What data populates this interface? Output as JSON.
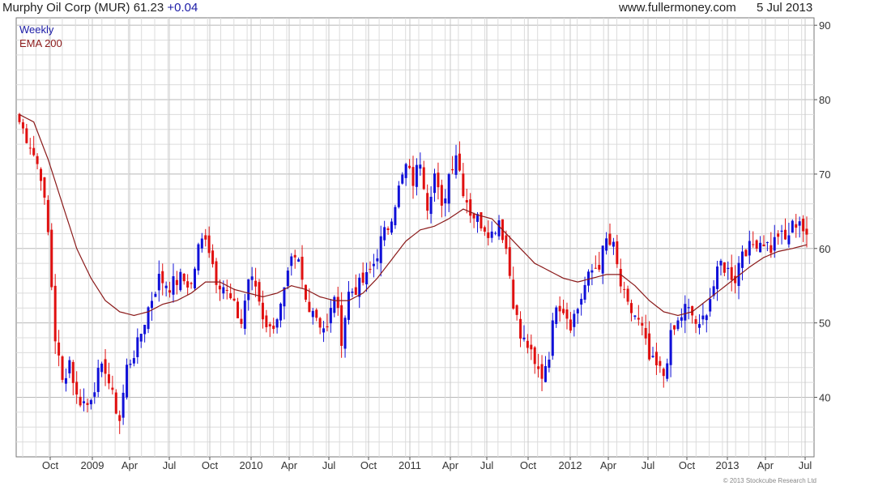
{
  "header": {
    "symbol_title": "Murphy Oil Corp (MUR)",
    "last_price": "61.23",
    "change": "+0.04",
    "website": "www.fullermoney.com",
    "date": "5 Jul 2013"
  },
  "footer": {
    "copyright": "© 2013 Stockcube Research Ltd"
  },
  "colors": {
    "up": "#1010d8",
    "down": "#e01010",
    "ema": "#8b1a1a",
    "grid": "#dcdcdc",
    "weekly_label": "#1a1aa6",
    "ema_label": "#8b1a1a"
  },
  "chart_data": {
    "type": "candlestick",
    "legend": [
      "Weekly",
      "EMA 200"
    ],
    "legend_position": "top-left",
    "grid": true,
    "y_axis_side": "right",
    "ylim": [
      32,
      91
    ],
    "y_ticks": [
      40,
      50,
      60,
      70,
      80,
      90
    ],
    "x_ticks": [
      "Oct",
      "2009",
      "Apr",
      "Jul",
      "Oct",
      "2010",
      "Apr",
      "Jul",
      "Oct",
      "2011",
      "Apr",
      "Jul",
      "Oct",
      "2012",
      "Apr",
      "Jul",
      "Oct",
      "2013",
      "Apr",
      "Jul"
    ],
    "week_close_anchors": [
      [
        0,
        77
      ],
      [
        3,
        74
      ],
      [
        6,
        70
      ],
      [
        8,
        62
      ],
      [
        10,
        48
      ],
      [
        12,
        42
      ],
      [
        14,
        45
      ],
      [
        16,
        40
      ],
      [
        19,
        39
      ],
      [
        22,
        43
      ],
      [
        24,
        44
      ],
      [
        26,
        40
      ],
      [
        28,
        37
      ],
      [
        30,
        44
      ],
      [
        33,
        47
      ],
      [
        36,
        52
      ],
      [
        39,
        56
      ],
      [
        42,
        55
      ],
      [
        45,
        56
      ],
      [
        48,
        55
      ],
      [
        50,
        60
      ],
      [
        52,
        62
      ],
      [
        55,
        56
      ],
      [
        57,
        55
      ],
      [
        60,
        52
      ],
      [
        62,
        50
      ],
      [
        64,
        56
      ],
      [
        66,
        55
      ],
      [
        68,
        51
      ],
      [
        70,
        49
      ],
      [
        73,
        52
      ],
      [
        76,
        58
      ],
      [
        78,
        58
      ],
      [
        80,
        53
      ],
      [
        82,
        52
      ],
      [
        84,
        50
      ],
      [
        86,
        49
      ],
      [
        88,
        54
      ],
      [
        90,
        48
      ],
      [
        92,
        54
      ],
      [
        95,
        55
      ],
      [
        97,
        56
      ],
      [
        99,
        58
      ],
      [
        101,
        61
      ],
      [
        103,
        63
      ],
      [
        106,
        68
      ],
      [
        108,
        71
      ],
      [
        110,
        69
      ],
      [
        112,
        72
      ],
      [
        114,
        66
      ],
      [
        116,
        70
      ],
      [
        118,
        65
      ],
      [
        120,
        70
      ],
      [
        122,
        73
      ],
      [
        124,
        68
      ],
      [
        126,
        65
      ],
      [
        128,
        64
      ],
      [
        130,
        63
      ],
      [
        132,
        62
      ],
      [
        134,
        64
      ],
      [
        136,
        60
      ],
      [
        138,
        53
      ],
      [
        140,
        48
      ],
      [
        142,
        47
      ],
      [
        144,
        44
      ],
      [
        146,
        43
      ],
      [
        148,
        46
      ],
      [
        150,
        53
      ],
      [
        152,
        52
      ],
      [
        154,
        50
      ],
      [
        156,
        52
      ],
      [
        158,
        55
      ],
      [
        160,
        57
      ],
      [
        162,
        58
      ],
      [
        164,
        61
      ],
      [
        166,
        60
      ],
      [
        168,
        55
      ],
      [
        170,
        52
      ],
      [
        172,
        51
      ],
      [
        174,
        49
      ],
      [
        176,
        45
      ],
      [
        178,
        44
      ],
      [
        180,
        43
      ],
      [
        182,
        48
      ],
      [
        184,
        50
      ],
      [
        186,
        52
      ],
      [
        188,
        51
      ],
      [
        190,
        49
      ],
      [
        192,
        52
      ],
      [
        194,
        55
      ],
      [
        196,
        58
      ],
      [
        198,
        57
      ],
      [
        200,
        56
      ],
      [
        202,
        60
      ],
      [
        204,
        60
      ],
      [
        206,
        61
      ],
      [
        208,
        61
      ],
      [
        210,
        60
      ],
      [
        212,
        62
      ],
      [
        214,
        61
      ],
      [
        216,
        63
      ],
      [
        218,
        64
      ],
      [
        220,
        61
      ]
    ],
    "ema_anchors": [
      [
        0,
        78
      ],
      [
        4,
        77
      ],
      [
        8,
        72
      ],
      [
        12,
        66
      ],
      [
        16,
        60
      ],
      [
        20,
        56
      ],
      [
        24,
        53
      ],
      [
        28,
        51.5
      ],
      [
        32,
        51
      ],
      [
        36,
        51.5
      ],
      [
        40,
        52.5
      ],
      [
        44,
        53
      ],
      [
        48,
        54
      ],
      [
        52,
        55.5
      ],
      [
        56,
        55.5
      ],
      [
        60,
        54.5
      ],
      [
        64,
        54
      ],
      [
        68,
        53.5
      ],
      [
        72,
        54
      ],
      [
        76,
        55
      ],
      [
        80,
        54.5
      ],
      [
        84,
        53.5
      ],
      [
        88,
        53
      ],
      [
        92,
        53
      ],
      [
        96,
        54
      ],
      [
        100,
        56
      ],
      [
        104,
        58.5
      ],
      [
        108,
        61
      ],
      [
        112,
        62.5
      ],
      [
        116,
        63
      ],
      [
        120,
        64
      ],
      [
        124,
        65.3
      ],
      [
        128,
        64.5
      ],
      [
        132,
        64
      ],
      [
        136,
        62
      ],
      [
        140,
        60
      ],
      [
        144,
        58
      ],
      [
        148,
        57
      ],
      [
        152,
        56
      ],
      [
        156,
        55.5
      ],
      [
        160,
        56
      ],
      [
        164,
        56.5
      ],
      [
        168,
        56.5
      ],
      [
        172,
        55
      ],
      [
        176,
        53
      ],
      [
        180,
        51.5
      ],
      [
        184,
        51
      ],
      [
        188,
        51.5
      ],
      [
        192,
        53
      ],
      [
        196,
        54.5
      ],
      [
        200,
        56
      ],
      [
        204,
        57.5
      ],
      [
        208,
        58.8
      ],
      [
        212,
        59.6
      ],
      [
        216,
        60
      ],
      [
        220,
        60.5
      ]
    ]
  }
}
